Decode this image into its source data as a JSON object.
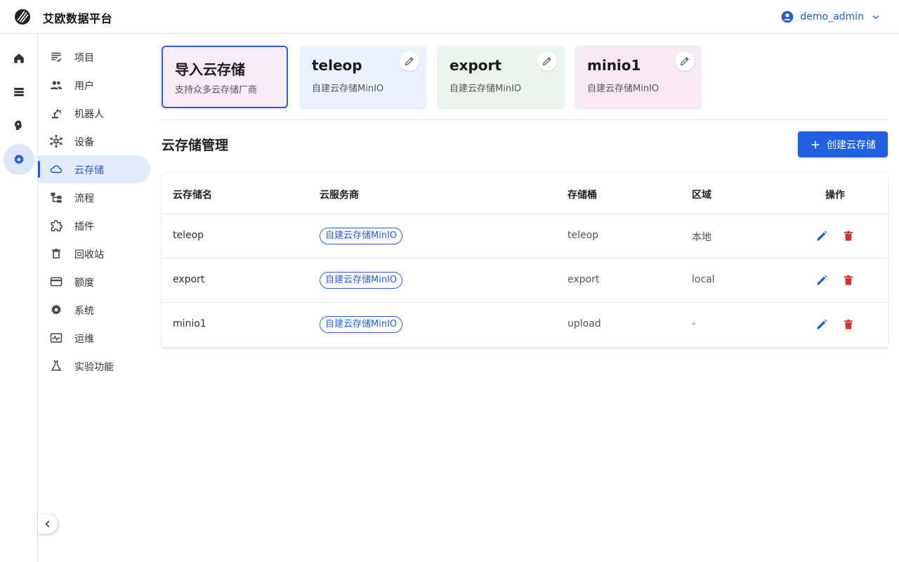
{
  "app": {
    "title": "艾欧数据平台",
    "user": "demo_admin"
  },
  "rail": {
    "items": [
      "home-icon",
      "storage-icon",
      "brain-icon",
      "settings-icon"
    ],
    "active": "settings-icon"
  },
  "sidebar": {
    "items": [
      {
        "label": "项目",
        "icon": "project-icon"
      },
      {
        "label": "用户",
        "icon": "users-icon"
      },
      {
        "label": "机器人",
        "icon": "robot-arm-icon"
      },
      {
        "label": "设备",
        "icon": "device-hub-icon"
      },
      {
        "label": "云存储",
        "icon": "cloud-icon"
      },
      {
        "label": "流程",
        "icon": "workflow-icon"
      },
      {
        "label": "插件",
        "icon": "plugin-icon"
      },
      {
        "label": "回收站",
        "icon": "trash-icon"
      },
      {
        "label": "额度",
        "icon": "credit-card-icon"
      },
      {
        "label": "系统",
        "icon": "gear-icon"
      },
      {
        "label": "运维",
        "icon": "monitor-icon"
      },
      {
        "label": "实验功能",
        "icon": "flask-icon"
      }
    ],
    "active": "云存储"
  },
  "cards": [
    {
      "title": "导入云存储",
      "subtitle": "支持众多云存储厂商"
    },
    {
      "title": "teleop",
      "subtitle": "自建云存储MinIO"
    },
    {
      "title": "export",
      "subtitle": "自建云存储MinIO"
    },
    {
      "title": "minio1",
      "subtitle": "自建云存储MinIO"
    }
  ],
  "section": {
    "title": "云存储管理",
    "create_label": "创建云存储"
  },
  "table": {
    "headers": [
      "云存储名",
      "云服务商",
      "存储桶",
      "区域",
      "操作"
    ],
    "rows": [
      {
        "name": "teleop",
        "provider": "自建云存储MinIO",
        "bucket": "teleop",
        "region": "本地"
      },
      {
        "name": "export",
        "provider": "自建云存储MinIO",
        "bucket": "export",
        "region": "local"
      },
      {
        "name": "minio1",
        "provider": "自建云存储MinIO",
        "bucket": "upload",
        "region": "-"
      }
    ]
  },
  "colors": {
    "accent": "#2160e0",
    "danger": "#d32f2f"
  }
}
